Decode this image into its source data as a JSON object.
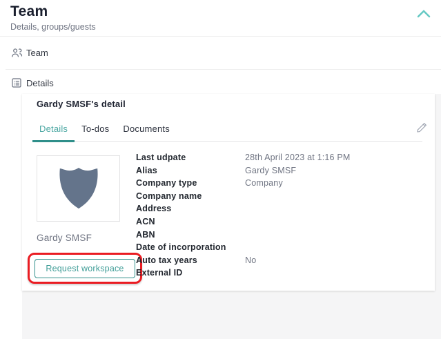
{
  "header": {
    "title": "Team",
    "subtitle": "Details, groups/guests",
    "collapse_icon": "chevron-up-icon"
  },
  "nav": {
    "items": [
      {
        "label": "Team",
        "icon": "people-group-icon"
      },
      {
        "label": "Details",
        "icon": "list-details-icon"
      }
    ]
  },
  "card": {
    "title": "Gardy SMSF's detail",
    "tabs": [
      {
        "label": "Details",
        "active": true
      },
      {
        "label": "To-dos",
        "active": false
      },
      {
        "label": "Documents",
        "active": false
      }
    ],
    "edit_icon": "pencil-icon",
    "avatar": {
      "icon": "shield-placeholder-icon",
      "caption": "Gardy SMSF"
    },
    "request_button_label": "Request workspace",
    "fields": [
      {
        "label": "Last udpate",
        "value": "28th April 2023 at 1:16 PM"
      },
      {
        "label": "Alias",
        "value": "Gardy SMSF"
      },
      {
        "label": "Company type",
        "value": "Company"
      },
      {
        "label": "Company name",
        "value": ""
      },
      {
        "label": "Address",
        "value": ""
      },
      {
        "label": "ACN",
        "value": ""
      },
      {
        "label": "ABN",
        "value": ""
      },
      {
        "label": "Date of incorporation",
        "value": ""
      },
      {
        "label": "Auto tax years",
        "value": "No"
      },
      {
        "label": "External ID",
        "value": ""
      }
    ]
  },
  "annotation": {
    "type": "red-highlight-box",
    "color": "#ea1c22"
  },
  "colors": {
    "accent_teal": "#2f8f8a",
    "active_tab_teal": "#4ba7a2",
    "light_teal_chevron": "#66c9c4",
    "annotation_red": "#ea1c22",
    "shield_gray": "#64748b",
    "panel_gray": "#f5f5f6"
  }
}
